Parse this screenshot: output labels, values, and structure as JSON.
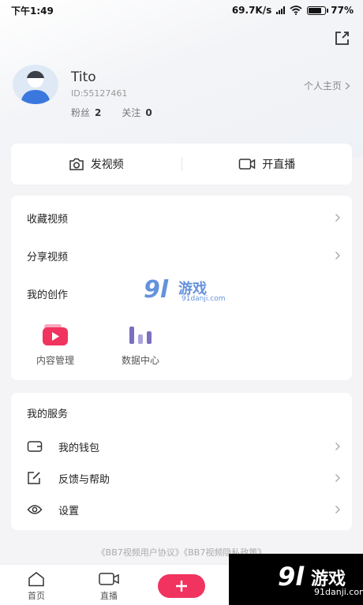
{
  "status_bar": {
    "time": "下午1:49",
    "network_speed": "69.7K/s",
    "battery_percent": "77%",
    "battery_level": 0.77
  },
  "profile": {
    "name": "Tito",
    "id": "ID:55127461",
    "fans_label": "粉丝",
    "fans_count": "2",
    "following_label": "关注",
    "following_count": "0",
    "homepage_link": "个人主页"
  },
  "actions": {
    "upload_video": "发视频",
    "go_live": "开直播"
  },
  "menu": {
    "favorites": "收藏视频",
    "share": "分享视频",
    "creation_title": "我的创作",
    "tools": [
      {
        "label": "内容管理",
        "icon": "play-icon"
      },
      {
        "label": "数据中心",
        "icon": "bar-chart-icon"
      }
    ]
  },
  "services": {
    "title": "我的服务",
    "items": [
      {
        "label": "我的钱包",
        "icon": "wallet-icon"
      },
      {
        "label": "反馈与帮助",
        "icon": "edit-icon"
      },
      {
        "label": "设置",
        "icon": "eye-icon"
      }
    ]
  },
  "agreement_text": "《BB7视频用户协议》《BB7视频隐私政策》",
  "tabbar": {
    "home": "首页",
    "live": "直播"
  },
  "watermark": {
    "logo_number": "9l",
    "logo_text": "游戏",
    "site": "91danji.com"
  },
  "colors": {
    "accent": "#f1335f",
    "chart_purple": "#7a6fc0",
    "watermark_blue": "#4b7fd6"
  }
}
